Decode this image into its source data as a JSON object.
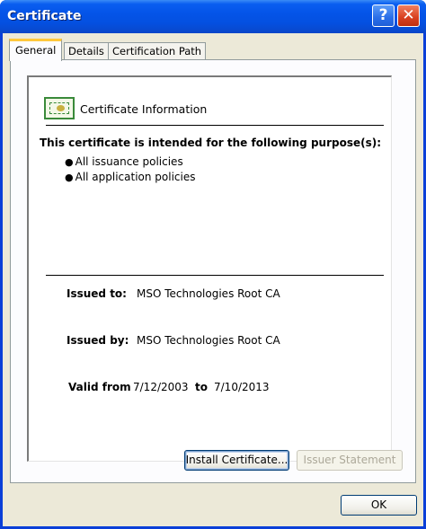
{
  "window": {
    "title": "Certificate",
    "help_glyph": "?",
    "close_glyph": "✕",
    "titlebar_color": "#0454e8"
  },
  "tabs": [
    {
      "label": "General",
      "active": true
    },
    {
      "label": "Details",
      "active": false
    },
    {
      "label": "Certification Path",
      "active": false
    }
  ],
  "general": {
    "icon": "certificate-icon",
    "heading": "Certificate Information",
    "purpose_heading": "This certificate is intended for the following purpose(s):",
    "purposes": [
      "All issuance policies",
      "All application policies"
    ],
    "issued_to_label": "Issued to:",
    "issued_to_value": "MSO Technologies Root CA",
    "issued_by_label": "Issued by:",
    "issued_by_value": "MSO Technologies Root CA",
    "valid_from_label": "Valid from",
    "valid_from_value": "7/12/2003",
    "valid_to_label": "to",
    "valid_to_value": "7/10/2013"
  },
  "buttons": {
    "install": "Install Certificate...",
    "issuer_statement": "Issuer Statement",
    "ok": "OK"
  }
}
